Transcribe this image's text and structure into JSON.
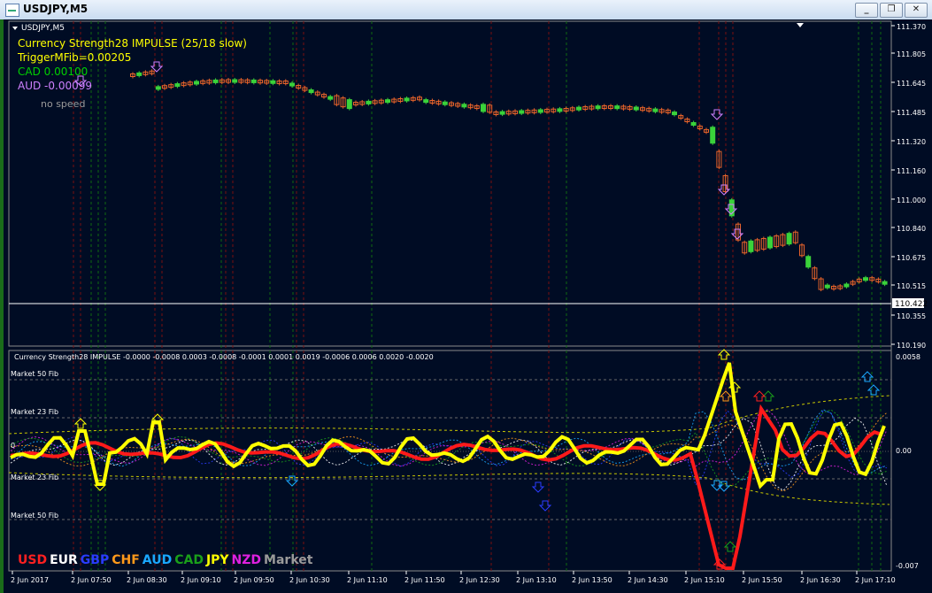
{
  "window": {
    "title": "USDJPY,M5",
    "minimize": "_",
    "restore": "❐",
    "close": "✕"
  },
  "chart": {
    "symbol_tab": "USDJPY,M5",
    "info_lines": [
      {
        "text": "Currency Strength28 IMPULSE (25/18 slow)",
        "color": "#ffff00"
      },
      {
        "text": "TriggerMFib=0.00205",
        "color": "#ffff00"
      },
      {
        "text": "CAD 0.00100",
        "color": "#00d000"
      },
      {
        "text": "AUD -0.00099",
        "color": "#d080ff"
      }
    ],
    "speed_label": "no speed",
    "current_price": "110.422",
    "price_ticks": [
      "111.370",
      "111.805",
      "111.645",
      "111.485",
      "111.320",
      "111.160",
      "111.000",
      "110.840",
      "110.675",
      "110.515",
      "110.355",
      "110.190"
    ],
    "indicator_title": "Currency Strength28 IMPULSE  -0.0000 -0.0008 0.0003 -0.0008 -0.0001 0.0001 0.0019 -0.0006 0.0006 0.0020 -0.0020",
    "indicator_ticks": [
      "0.0058",
      "0.00",
      "-0.007"
    ],
    "fib_levels": [
      "Market 50 Fib",
      "Market 23 Fib",
      "Market 23 Fib",
      "Market 50 Fib"
    ],
    "zero_label": "0",
    "time_labels": [
      "2 Jun 2017",
      "2 Jun 07:50",
      "2 Jun 08:30",
      "2 Jun 09:10",
      "2 Jun 09:50",
      "2 Jun 10:30",
      "2 Jun 11:10",
      "2 Jun 11:50",
      "2 Jun 12:30",
      "2 Jun 13:10",
      "2 Jun 13:50",
      "2 Jun 14:30",
      "2 Jun 15:10",
      "2 Jun 15:50",
      "2 Jun 16:30",
      "2 Jun 17:10"
    ],
    "legend": [
      {
        "text": "USD",
        "color": "#ff2020"
      },
      {
        "text": "EUR",
        "color": "#ffffff"
      },
      {
        "text": "GBP",
        "color": "#2a3cff"
      },
      {
        "text": "CHF",
        "color": "#ff9a1a"
      },
      {
        "text": "AUD",
        "color": "#1aa8ff"
      },
      {
        "text": "CAD",
        "color": "#1aa01a"
      },
      {
        "text": "JPY",
        "color": "#ffff00"
      },
      {
        "text": "NZD",
        "color": "#e020e0"
      },
      {
        "text": "Market",
        "color": "#9a9a9a"
      }
    ]
  }
}
